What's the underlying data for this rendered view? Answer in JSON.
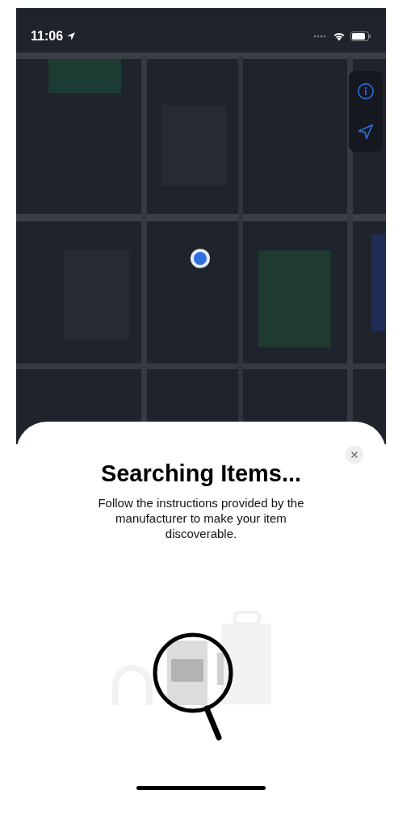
{
  "status_bar": {
    "time": "11:06"
  },
  "sheet": {
    "title": "Searching Items...",
    "message": "Follow the instructions provided by the manufacturer to make your item discoverable."
  }
}
